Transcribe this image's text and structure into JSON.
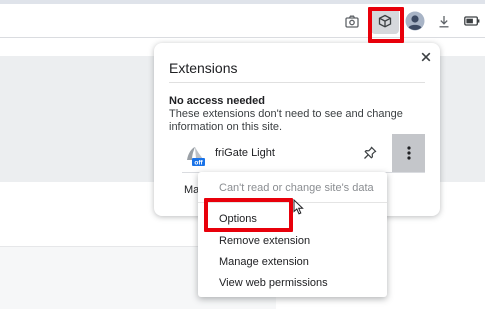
{
  "toolbar": {
    "icons": [
      "camera-icon",
      "extensions-puzzle-icon",
      "profile-icon",
      "download-icon",
      "battery-icon"
    ]
  },
  "popup": {
    "title": "Extensions",
    "section_heading": "No access needed",
    "section_description": "These extensions don't need to see and change information on this site.",
    "extension": {
      "name": "friGate Light",
      "icon_badge": "off"
    },
    "manage_label": "Ma"
  },
  "context_menu": {
    "items": [
      {
        "label": "Can't read or change site's data",
        "enabled": false
      },
      {
        "label": "Options",
        "enabled": true
      },
      {
        "label": "Remove extension",
        "enabled": true
      },
      {
        "label": "Manage extension",
        "enabled": true
      },
      {
        "label": "View web permissions",
        "enabled": true
      }
    ]
  },
  "colors": {
    "highlight": "#e8000b",
    "extension_badge": "#1a73e8",
    "more_button_active": "#c4c6ca"
  }
}
